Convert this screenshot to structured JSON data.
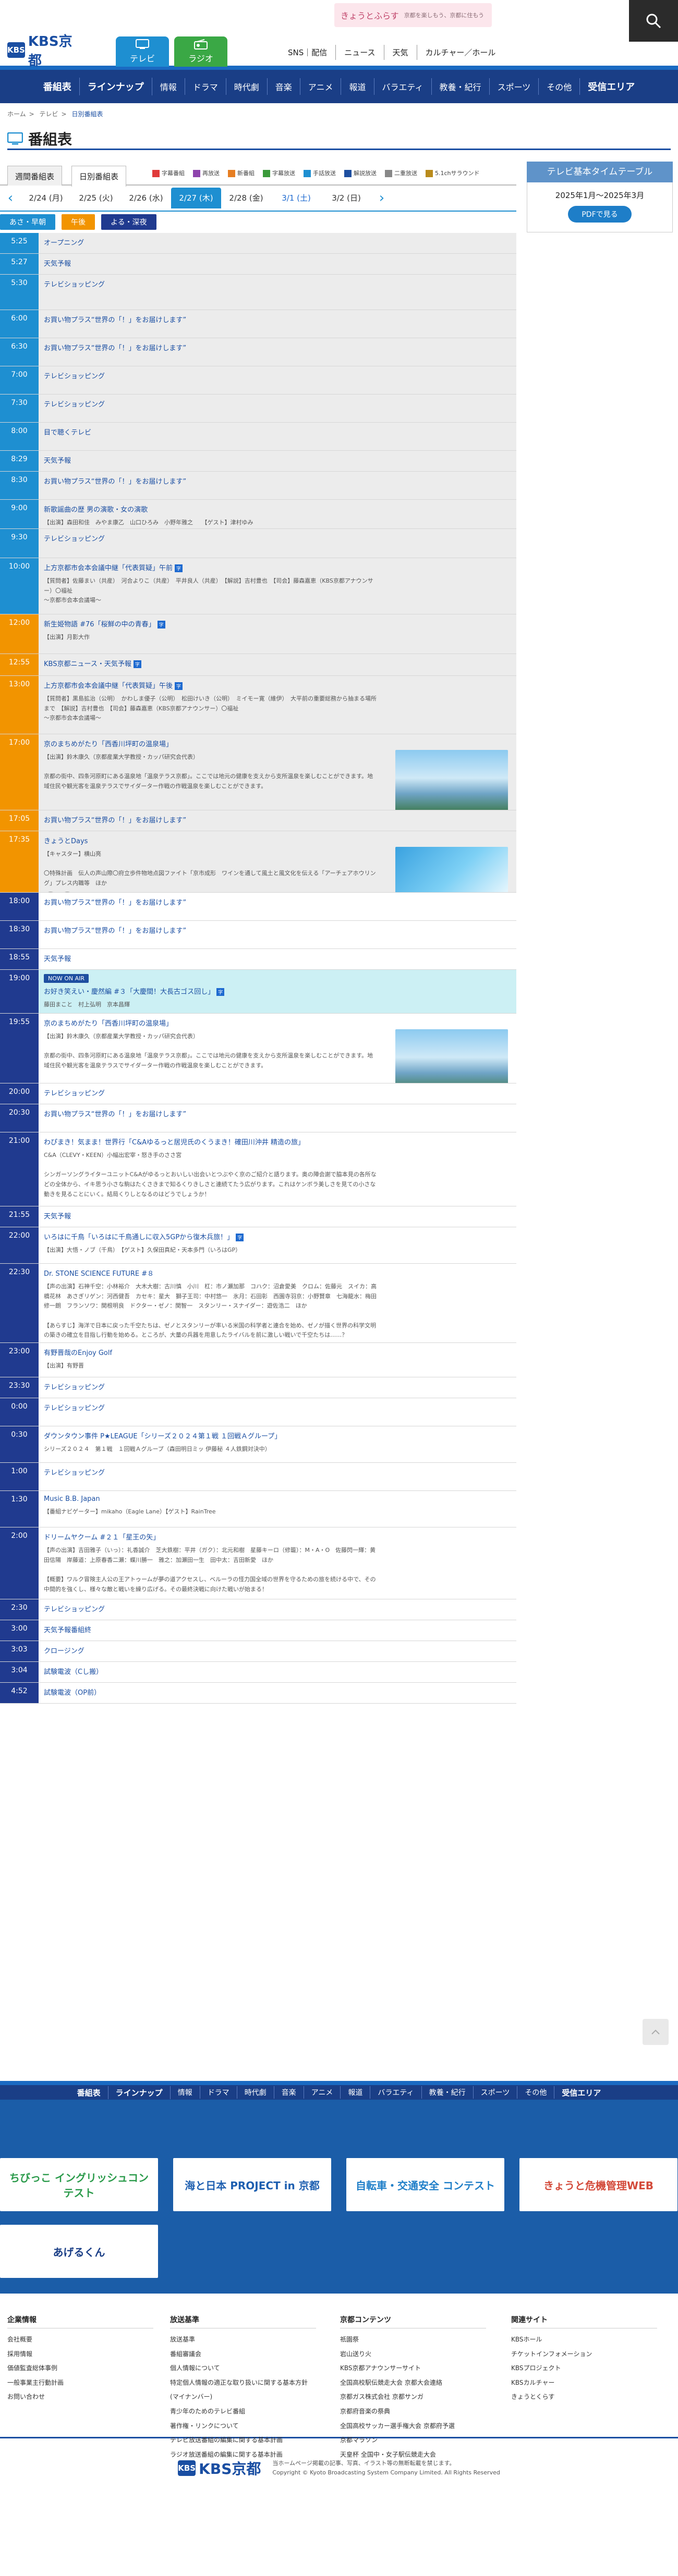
{
  "header": {
    "logo": "KBS京都",
    "logo_mark": "KBS",
    "tabs": [
      {
        "label": "テレビ"
      },
      {
        "label": "ラジオ"
      }
    ],
    "links": [
      {
        "label": "SNS｜配信"
      },
      {
        "label": "ニュース"
      },
      {
        "label": "天気"
      },
      {
        "label": "カルチャー／ホール"
      }
    ],
    "banner_title": "きょうとふらす",
    "banner_sub": "京都を楽しもう、京都に住もう"
  },
  "gnav": [
    "番組表",
    "ラインナップ",
    "情報",
    "ドラマ",
    "時代劇",
    "音楽",
    "アニメ",
    "報道",
    "バラエティ",
    "教養・紀行",
    "スポーツ",
    "その他",
    "受信エリア"
  ],
  "breadcrumb": {
    "home": "ホーム",
    "tv": "テレビ",
    "current": "日別番組表"
  },
  "page_title": "番組表",
  "tabs": {
    "weekly": "週間番組表",
    "daily": "日別番組表"
  },
  "legend": [
    {
      "label": "字幕番組",
      "color": "#e03a3a"
    },
    {
      "label": "再放送",
      "color": "#8e44ad"
    },
    {
      "label": "新番組",
      "color": "#e67e22"
    },
    {
      "label": "字幕放送",
      "color": "#3a9a3a"
    },
    {
      "label": "手話放送",
      "color": "#1e8fd1"
    },
    {
      "label": "解説放送",
      "color": "#1e4fa0"
    },
    {
      "label": "二重放送",
      "color": "#888888"
    },
    {
      "label": "5.1chサラウンド",
      "color": "#b98b1c"
    }
  ],
  "dates": [
    {
      "label": "2/24 (月)",
      "type": "normal"
    },
    {
      "label": "2/25 (火)",
      "type": "normal"
    },
    {
      "label": "2/26 (水)",
      "type": "normal"
    },
    {
      "label": "2/27 (木)",
      "type": "on"
    },
    {
      "label": "2/28 (金)",
      "type": "normal"
    },
    {
      "label": "3/1 (土)",
      "type": "sat"
    },
    {
      "label": "3/2 (日)",
      "type": "normal"
    }
  ],
  "timebar": [
    {
      "label": "あさ・早朝",
      "color": "#1e8fd1"
    },
    {
      "label": "午後",
      "color": "#f29400"
    },
    {
      "label": "よる・深夜",
      "color": "#203a8f"
    }
  ],
  "sidebar": {
    "title": "テレビ基本タイムテーブル",
    "period": "2025年1月〜2025年3月",
    "pdf": "PDFで見る"
  },
  "programs": [
    {
      "time": "5:25",
      "title": "オープニング",
      "cls": "m",
      "h": 40
    },
    {
      "time": "5:27",
      "title": "天気予報",
      "cls": "m",
      "h": 40
    },
    {
      "time": "5:30",
      "title": "テレビショッピング",
      "cls": "m",
      "h": 68
    },
    {
      "time": "6:00",
      "title": "お買い物プラス“世界の「！」をお届けします”",
      "cls": "m",
      "h": 54
    },
    {
      "time": "6:30",
      "title": "お買い物プラス“世界の「！」をお届けします”",
      "cls": "m",
      "h": 54
    },
    {
      "time": "7:00",
      "title": "テレビショッピング",
      "cls": "m",
      "h": 54
    },
    {
      "time": "7:30",
      "title": "テレビショッピング",
      "cls": "m",
      "h": 54
    },
    {
      "time": "8:00",
      "title": "目で聴くテレビ",
      "cls": "m",
      "h": 54
    },
    {
      "time": "8:29",
      "title": "天気予報",
      "cls": "m",
      "h": 40
    },
    {
      "time": "8:30",
      "title": "お買い物プラス“世界の「！」をお届けします”",
      "cls": "m",
      "h": 54
    },
    {
      "time": "9:00",
      "title": "新歌謡曲の歴 男の演歌・女の演歌",
      "desc": "【出演】森田和佳　みやま康乙　山口ひろみ　小野年雅之　　【ゲスト】津村ゆみ",
      "cls": "m",
      "h": 56
    },
    {
      "time": "9:30",
      "title": "テレビショッピング",
      "cls": "m",
      "h": 56
    },
    {
      "time": "10:00",
      "title": "上方京都市会本会議中継「代表質疑」午前",
      "badge": "字",
      "desc": "【質問者】佐藤まい（共産）　河合よりこ（共産）　平井良人（共産）　【解説】吉村豊也　【司会】藤森嘉恵（KBS京都アナウンサー）〇福祉\n〜京都市会本会議場〜",
      "cls": "m",
      "h": 108
    },
    {
      "time": "12:00",
      "title": "新生姫物語 #76「桜鮮の中の青春」",
      "badge": "字",
      "desc": "【出演】月影大作",
      "cls": "d",
      "h": 76
    },
    {
      "time": "12:55",
      "title": "KBS京都ニュース・天気予報",
      "badge": "字",
      "cls": "d",
      "h": 42
    },
    {
      "time": "13:00",
      "title": "上方京都市会本会議中継「代表質疑」午後",
      "badge": "字",
      "desc": "【質問者】黒島拡治（公明）　かわしま優子（公明）　松田けいき（公明）　ミイモー寛（維伊）　大平前の重要総務から抽まる場所まで　【解説】吉村豊也　【司会】藤森嘉恵（KBS京都アナウンサー）〇福祉\n〜京都市会本会議場〜",
      "cls": "d",
      "h": 112
    },
    {
      "time": "17:00",
      "title": "京のまちめがたり「西香川坪町の温泉場」",
      "desc": "【出演】鈴木康久（京都産業大学教授・カッパ研究会代表）\n\n京都の街中、四条河原町にある温泉地「温泉テラス京都」。ここでは地元の健康を支えから支所温泉を楽しむことができます。地域住民や観光客を温泉テラスでサイダーター作戦の作戦温泉を楽しむことができます。",
      "thumb": "a",
      "cls": "d",
      "h": 146
    },
    {
      "time": "17:05",
      "title": "お買い物プラス“世界の「！」をお届けします”",
      "cls": "d",
      "h": 40
    },
    {
      "time": "17:35",
      "title": "きょうとDays",
      "desc": "【キャスター】横山亮\n\n〇特殊計画　伝人の声山際〇府立歩件物地点図ファイト「京市成形　ワインを通して風土と風文化を伝える「アーチェアホウリング」プレス内職等　ほか",
      "thumb": "b",
      "icons": true,
      "cls": "d",
      "h": 118
    },
    {
      "time": "18:00",
      "title": "お買い物プラス“世界の「！」をお届けします”",
      "cls": "n",
      "h": 54
    },
    {
      "time": "18:30",
      "title": "お買い物プラス“世界の「！」をお届けします”",
      "cls": "n",
      "h": 54
    },
    {
      "time": "18:55",
      "title": "天気予報",
      "cls": "n",
      "h": 40
    },
    {
      "time": "19:00",
      "title": "お好き笑えい・慶然編 #３「大慶間！大長古ゴス回し」",
      "badge": "字",
      "desc": "藤田まこと　村上弘明　京本昌輝",
      "onair": "NOW ON AIR",
      "cls": "n",
      "h": 84
    },
    {
      "time": "19:55",
      "title": "京のまちめがたり「西香川坪町の温泉場」",
      "desc": "【出演】鈴木康久（京都産業大学教授・カッパ研究会代表）\n\n京都の街中、四条河原町にある温泉地「温泉テラス京都」。ここでは地元の健康を支えから支所温泉を楽しむことができます。地域住民や観光客を温泉テラスでサイダーター作戦の作戦温泉を楽しむことができます。",
      "thumb": "a",
      "cls": "n",
      "h": 134
    },
    {
      "time": "20:00",
      "title": "テレビショッピング",
      "cls": "n",
      "h": 40
    },
    {
      "time": "20:30",
      "title": "お買い物プラス“世界の「！」をお届けします”",
      "cls": "n",
      "h": 54
    },
    {
      "time": "21:00",
      "title": "わぴまき！気まま！世界行「C&Aゆるっと居児氏のくうまき！確田川沖井 精造の旅」",
      "desc": "C&A（CLEVY・KEEN）小幅出宏宰・怒き手のささ宮\n\nシンガーソングライターユニットC&Aがゆるっとおいしい出会いとつぶやく京のご紹介と語ります。奥の陣会謝で脇本見の各所などの全体から、イキ思う小さな駒はたくさきまで知るくりきしさと連続てたう広がります。これはケンボラ美しさを見ての小さな動きを見ることにいく。結局くりしとなるのはどうでしょうか！",
      "cls": "n",
      "h": 142
    },
    {
      "time": "21:55",
      "title": "天気予報",
      "cls": "n",
      "h": 40
    },
    {
      "time": "22:00",
      "title": "いろはに千鳥「いろはに千鳥通しに収入5GPから復木兵旅！」",
      "badge": "字",
      "desc": "【出演】大悟・ノブ（千鳥）　【ゲスト】久保田真紀・天本多門（いろはGP）",
      "cls": "n",
      "h": 70
    },
    {
      "time": "22:30",
      "title": "Dr. STONE SCIENCE FUTURE #８",
      "desc": "【声の出演】石神千空：小林裕介　大木大樹：古川慎　小川　杠：市ノ瀬加那　コハク：沼倉愛美　クロム：佐藤元　スイカ：高橋花林　あさぎリゲン：河西健吾　カセキ：星大　獅子王司：中村悠一　氷月：石田彰　西園寺羽京：小野賢章　七海龍水：梅田修一朗　フランソワ：関根明良　ドクター・ゼノ：関智一　スタンリー・スナイダー：遊佐浩二　ほか\n\n【あらすじ】海洋で日本に戻った千空たちは、ゼノとスタンリーが率いる米国の科学者と連合を始め、ゼノが描く世界の科学文明の築きの確立を目指し行動を始める。ところが、大量の兵器を用意したライバルを前に激しい戦いで千空たちは……？",
      "cls": "n",
      "h": 152
    },
    {
      "time": "23:00",
      "title": "有野晋哉のEnjoy Golf",
      "desc": "【出演】有野晋",
      "cls": "n",
      "h": 66
    },
    {
      "time": "23:30",
      "title": "テレビショッピング",
      "cls": "n",
      "h": 40
    },
    {
      "time": "0:00",
      "title": "テレビショッピング",
      "cls": "n",
      "h": 54
    },
    {
      "time": "0:30",
      "title": "ダウンタウン事件 P★LEAGUE「シリーズ２０２４第１戦 １回戦Ａグループ」",
      "desc": "シリーズ２０２４　第１戦　１回戦Ａグループ（森田明日ミッ 伊藤秘 ４人鉄鋼対決中）",
      "cls": "n",
      "h": 70
    },
    {
      "time": "1:00",
      "title": "テレビショッピング",
      "cls": "n",
      "h": 54
    },
    {
      "time": "1:30",
      "title": "Music B.B. Japan",
      "desc": "【番組ナビゲーター】mikaho（Eagle Lane）【ゲスト】RainTree",
      "cls": "n",
      "h": 70
    },
    {
      "time": "2:00",
      "title": "ドリームヤクーム #２１「星王の矢」",
      "desc": "【声の出演】吉田雅子（いっ）：礼香誠介　芝大鉄樹：平井（ガク）：北元和樹　星藤キーロ（修籠）：M・A・O　佐藤閃一輝：黄田信陽　岸藤道：上原春香二瀬：蝶川勝一　雅之：加瀬田一生　田中太：吉田新愛　ほか\n\n【概要】ワルク冒険主人公の王アトゥームが夢の道アクセスし、ベルーラの怪力国全域の世界を守るための旅を続ける中で、その中間的を強くし、様々な敵と戦いを繰り広げる。その最終決戦に向けた戦いが始まる！",
      "cls": "n",
      "h": 138
    },
    {
      "time": "2:30",
      "title": "テレビショッピング",
      "cls": "n",
      "h": 40
    },
    {
      "time": "3:00",
      "title": "天気予報番組終",
      "cls": "n",
      "h": 40
    },
    {
      "time": "3:03",
      "title": "クロージング",
      "cls": "n",
      "h": 40
    },
    {
      "time": "3:04",
      "title": "試験電波（Cし搬）",
      "cls": "n",
      "h": 40
    },
    {
      "time": "4:52",
      "title": "試験電波（OP前）",
      "cls": "n",
      "h": 40
    }
  ],
  "bottom_nav": [
    "番組表",
    "ラインナップ",
    "情報",
    "ドラマ",
    "時代劇",
    "音楽",
    "アニメ",
    "報道",
    "バラエティ",
    "教養・紀行",
    "スポーツ",
    "その他",
    "受信エリア"
  ],
  "promos": [
    {
      "label": "ちびっこ イングリッシュコンテスト",
      "color": "#2a9a4a"
    },
    {
      "label": "海と日本 PROJECT in 京都",
      "color": "#1e5fb0"
    },
    {
      "label": "自転車・交通安全 コンテスト",
      "color": "#1e7ec8"
    },
    {
      "label": "きょうと危機管理WEB",
      "color": "#d34a3a"
    },
    {
      "label": "あげるくん",
      "color": "#e5c020"
    }
  ],
  "footer": {
    "cols": [
      {
        "head": "企業情報",
        "items": [
          "会社概要",
          "採用情報",
          "価値監査総体事例",
          "一般事業主行動計画",
          "お問い合わせ"
        ]
      },
      {
        "head": "放送基準",
        "items": [
          "放送基準",
          "番組審議会",
          "個人情報について",
          "特定個人情報の適正な取り扱いに関する基本方針(マイナンバー)",
          "青少年のためのテレビ番組",
          "著作権・リンクについて",
          "テレビ放送番組の編集に関する基本計画",
          "ラジオ放送番組の編集に関する基本計画"
        ]
      },
      {
        "head": "京都コンテンツ",
        "items": [
          "祇園祭",
          "岩山送り火",
          "KBS京都アナウンサーサイト",
          "全国高校駅伝競走大会 京都大会連絡",
          "京都ガス株式会社 京都サンガ",
          "京都府音楽の祭典",
          "全国高校サッカー選手権大会 京都府予選",
          "京都マラソン",
          "天皇杯 全国中・女子駅伝競走大会"
        ]
      },
      {
        "head": "関連サイト",
        "items": [
          "KBSホール",
          "チケットインフォメーション",
          "KBSプロジェクト",
          "KBSカルチャー",
          "きょうとくらす"
        ]
      }
    ],
    "copy_line1": "当ホームページ掲載の記事、写真、イラスト等の無断転載を禁じます。",
    "copy_line2": "Copyright © Kyoto Broadcasting System Company Limited. All Rights Reserved"
  }
}
